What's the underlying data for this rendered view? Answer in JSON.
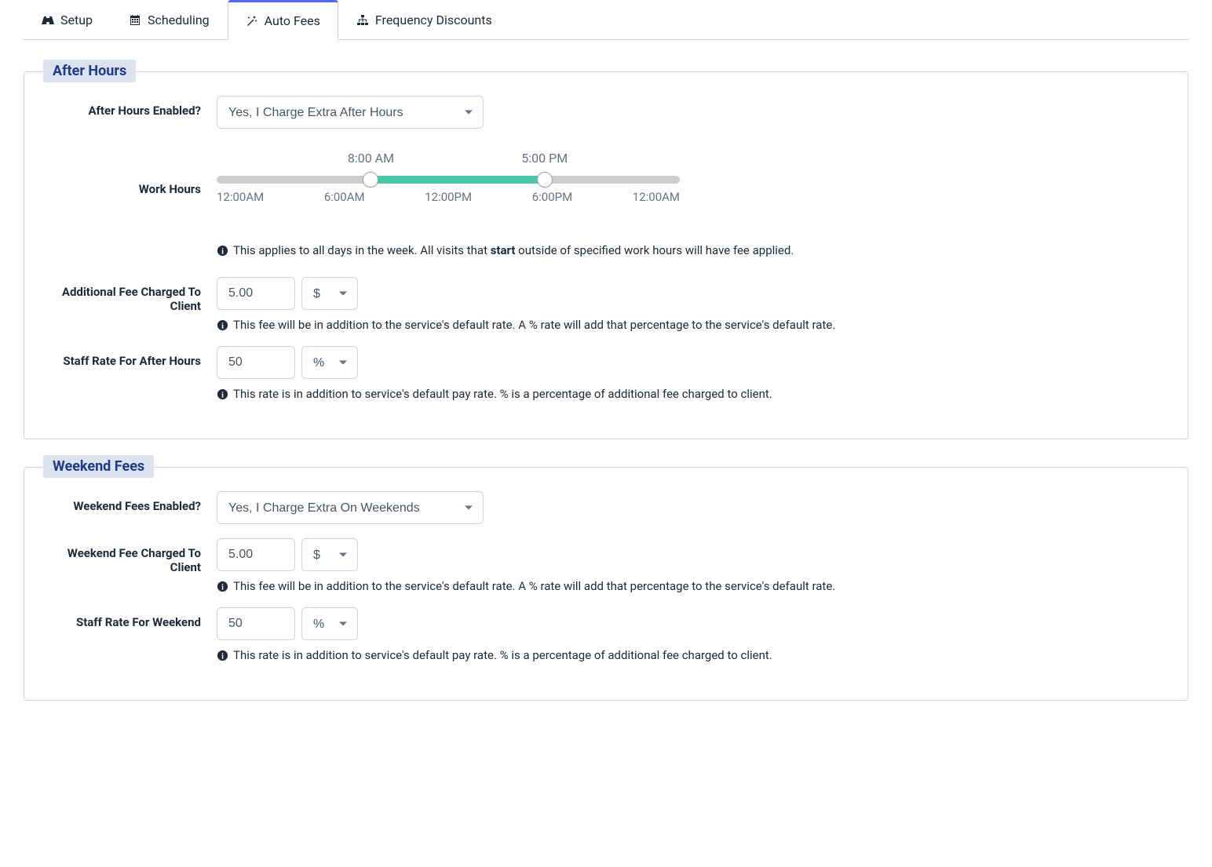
{
  "tabs": [
    {
      "label": "Setup",
      "icon": "road"
    },
    {
      "label": "Scheduling",
      "icon": "calendar"
    },
    {
      "label": "Auto Fees",
      "icon": "magic",
      "active": true
    },
    {
      "label": "Frequency Discounts",
      "icon": "sitemap"
    }
  ],
  "after_hours": {
    "legend": "After Hours",
    "enabled_label": "After Hours Enabled?",
    "enabled_value": "Yes, I Charge Extra After Hours",
    "work_hours_label": "Work Hours",
    "slider": {
      "start_label": "8:00 AM",
      "end_label": "5:00 PM",
      "start_pct": 33.3,
      "end_pct": 70.8,
      "ticks": [
        "12:00AM",
        "6:00AM",
        "12:00PM",
        "6:00PM",
        "12:00AM"
      ]
    },
    "work_hours_help_pre": "This applies to all days in the week. All visits that ",
    "work_hours_help_bold": "start",
    "work_hours_help_post": " outside of specified work hours will have fee applied.",
    "fee_label": "Additional Fee Charged To Client",
    "fee_value": "5.00",
    "fee_unit": "$",
    "fee_help": "This fee will be in addition to the service's default rate. A % rate will add that percentage to the service's default rate.",
    "staff_label": "Staff Rate For After Hours",
    "staff_value": "50",
    "staff_unit": "%",
    "staff_help": "This rate is in addition to service's default pay rate. % is a percentage of additional fee charged to client."
  },
  "weekend": {
    "legend": "Weekend Fees",
    "enabled_label": "Weekend Fees Enabled?",
    "enabled_value": "Yes, I Charge Extra On Weekends",
    "fee_label": "Weekend Fee Charged To Client",
    "fee_value": "5.00",
    "fee_unit": "$",
    "fee_help": "This fee will be in addition to the service's default rate. A % rate will add that percentage to the service's default rate.",
    "staff_label": "Staff Rate For Weekend",
    "staff_value": "50",
    "staff_unit": "%",
    "staff_help": "This rate is in addition to service's default pay rate. % is a percentage of additional fee charged to client."
  }
}
